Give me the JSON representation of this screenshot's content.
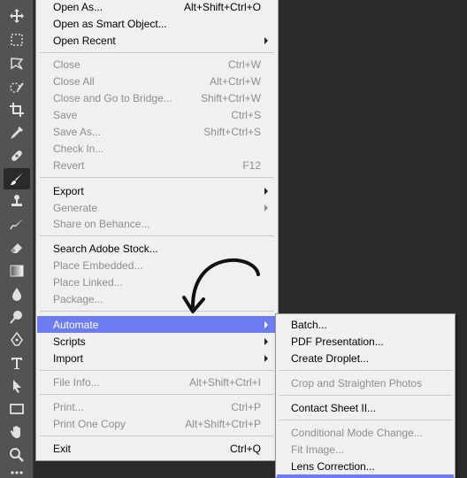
{
  "toolbar": {
    "tools": [
      {
        "name": "move-tool-icon"
      },
      {
        "name": "marquee-tool-icon"
      },
      {
        "name": "lasso-tool-icon"
      },
      {
        "name": "quick-selection-tool-icon"
      },
      {
        "name": "crop-tool-icon"
      },
      {
        "name": "eyedropper-tool-icon"
      },
      {
        "name": "healing-brush-tool-icon"
      },
      {
        "name": "brush-tool-icon"
      },
      {
        "name": "clone-stamp-tool-icon"
      },
      {
        "name": "history-brush-tool-icon"
      },
      {
        "name": "eraser-tool-icon"
      },
      {
        "name": "gradient-tool-icon"
      },
      {
        "name": "blur-tool-icon"
      },
      {
        "name": "dodge-tool-icon"
      },
      {
        "name": "pen-tool-icon"
      },
      {
        "name": "type-tool-icon",
        "glyph": "T"
      },
      {
        "name": "path-selection-tool-icon"
      },
      {
        "name": "rectangle-tool-icon"
      },
      {
        "name": "hand-tool-icon"
      },
      {
        "name": "zoom-tool-icon"
      }
    ],
    "active_tool": "brush-tool-icon"
  },
  "file_menu": {
    "items": {
      "open_as": {
        "label": "Open As...",
        "shortcut": "Alt+Shift+Ctrl+O"
      },
      "open_smart": {
        "label": "Open as Smart Object..."
      },
      "open_recent": {
        "label": "Open Recent"
      },
      "close": {
        "label": "Close",
        "shortcut": "Ctrl+W"
      },
      "close_all": {
        "label": "Close All",
        "shortcut": "Alt+Ctrl+W"
      },
      "close_bridge": {
        "label": "Close and Go to Bridge...",
        "shortcut": "Shift+Ctrl+W"
      },
      "save": {
        "label": "Save",
        "shortcut": "Ctrl+S"
      },
      "save_as": {
        "label": "Save As...",
        "shortcut": "Shift+Ctrl+S"
      },
      "check_in": {
        "label": "Check In..."
      },
      "revert": {
        "label": "Revert",
        "shortcut": "F12"
      },
      "export": {
        "label": "Export"
      },
      "generate": {
        "label": "Generate"
      },
      "share_behance": {
        "label": "Share on Behance..."
      },
      "search_stock": {
        "label": "Search Adobe Stock..."
      },
      "place_embedded": {
        "label": "Place Embedded..."
      },
      "place_linked": {
        "label": "Place Linked..."
      },
      "package": {
        "label": "Package..."
      },
      "automate": {
        "label": "Automate"
      },
      "scripts": {
        "label": "Scripts"
      },
      "import": {
        "label": "Import"
      },
      "file_info": {
        "label": "File Info...",
        "shortcut": "Alt+Shift+Ctrl+I"
      },
      "print": {
        "label": "Print...",
        "shortcut": "Ctrl+P"
      },
      "print_one": {
        "label": "Print One Copy",
        "shortcut": "Alt+Shift+Ctrl+P"
      },
      "exit": {
        "label": "Exit",
        "shortcut": "Ctrl+Q"
      }
    }
  },
  "automate_submenu": {
    "items": {
      "batch": {
        "label": "Batch..."
      },
      "pdf_presentation": {
        "label": "PDF Presentation..."
      },
      "create_droplet": {
        "label": "Create Droplet..."
      },
      "crop_straighten": {
        "label": "Crop and Straighten Photos"
      },
      "contact_sheet": {
        "label": "Contact Sheet II..."
      },
      "conditional_mode": {
        "label": "Conditional Mode Change..."
      },
      "fit_image": {
        "label": "Fit Image..."
      },
      "lens_correction": {
        "label": "Lens Correction..."
      }
    }
  },
  "colors": {
    "highlight": "#6d7cf0",
    "menu_bg": "#f0f0f0",
    "toolbar_bg": "#535353",
    "disabled_text": "#8d8d8d"
  }
}
